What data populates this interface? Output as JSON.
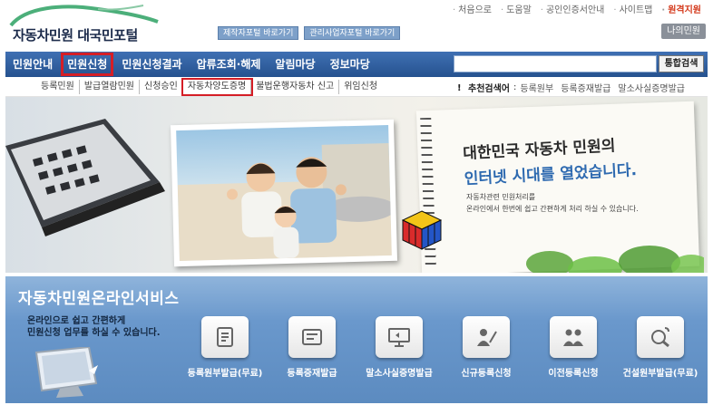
{
  "logo": {
    "text_main": "자동차민원",
    "text_sub": "대국민포털"
  },
  "portal_buttons": [
    "제작자포털 바로가기",
    "관리사업자포털 바로가기"
  ],
  "util_nav": [
    {
      "label": "처음으로",
      "highlight": false
    },
    {
      "label": "도움말",
      "highlight": false
    },
    {
      "label": "공인인증서안내",
      "highlight": false
    },
    {
      "label": "사이트맵",
      "highlight": false
    },
    {
      "label": "원격지원",
      "highlight": true
    }
  ],
  "my_button": "나의민원",
  "main_nav": {
    "items": [
      "민원안내",
      "민원신청",
      "민원신청결과",
      "압류조회·해제",
      "알림마당",
      "정보마당"
    ],
    "active_index": 1
  },
  "search": {
    "value": "",
    "button": "통합검색"
  },
  "sub_nav": {
    "items": [
      "등록민원",
      "발급열람민원",
      "신청승인",
      "자동차양도증명",
      "불법운행자동차 신고",
      "위임신청"
    ],
    "boxed_index": 3
  },
  "recommend": {
    "label": "추천검색어",
    "items": [
      "등록원부",
      "등록증재발급",
      "말소사실증명발급"
    ]
  },
  "banner": {
    "slogan_line1": "대한민국 자동차 민원의",
    "slogan_line2": "인터넷 시대를 열었습니다.",
    "desc_line1": "자동차관련 민원처리를",
    "desc_line2": "온라인에서 한번에 쉽고 간편하게 처리 하실 수 있습니다."
  },
  "service": {
    "title": "자동차민원온라인서비스",
    "desc_line1": "온라인으로 쉽고 간편하게",
    "desc_line2": "민원신청 업무를 하실 수 있습니다.",
    "items": [
      {
        "label": "등록원부발급(무료)",
        "icon": "document-icon"
      },
      {
        "label": "등록증재발급",
        "icon": "registration-card-icon"
      },
      {
        "label": "말소사실증명발급",
        "icon": "monitor-icon"
      },
      {
        "label": "신규등록신청",
        "icon": "person-pen-icon"
      },
      {
        "label": "이전등록신청",
        "icon": "transfer-people-icon"
      },
      {
        "label": "건설원부발급(무료)",
        "icon": "search-zoom-icon"
      }
    ]
  },
  "colors": {
    "nav_blue": "#2f5f9e",
    "highlight_red": "#d51e26",
    "remote_support": "#d4381a",
    "service_blue": "#6a98cc"
  }
}
